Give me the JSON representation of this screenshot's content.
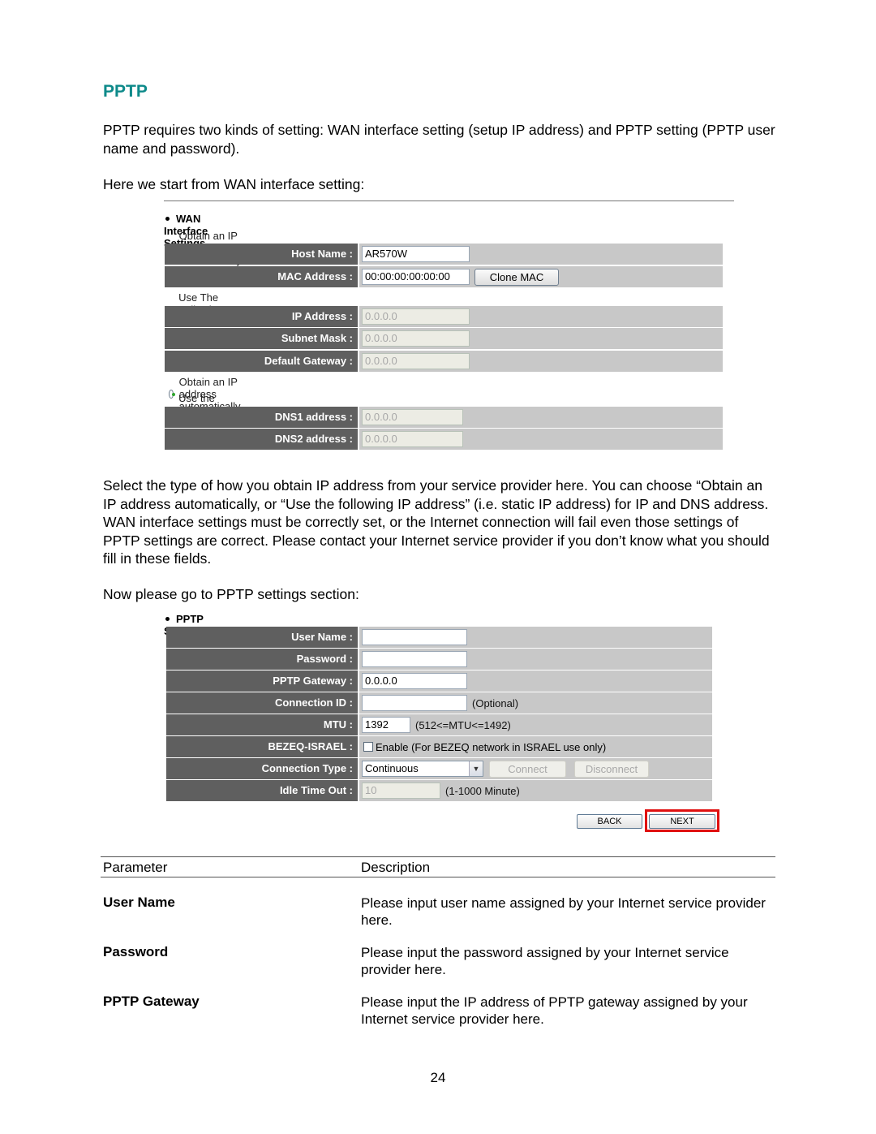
{
  "heading": "PPTP",
  "intro": "PPTP requires two kinds of setting: WAN interface setting (setup IP address) and PPTP setting (PPTP user name and password).",
  "wan_lead": "Here we start from WAN interface setting:",
  "wan_panel": {
    "title": "WAN Interface Settings",
    "radio_obtain_ip": "Obtain an IP Address Automatically",
    "host_name_label": "Host Name :",
    "host_name_value": "AR570W",
    "mac_label": "MAC Address :",
    "mac_value": "00:00:00:00:00:00",
    "clone_mac_button": "Clone MAC",
    "radio_use_ip": "Use The Following IP Address",
    "ip_label": "IP Address :",
    "ip_value": "0.0.0.0",
    "subnet_label": "Subnet Mask :",
    "subnet_value": "0.0.0.0",
    "gateway_label": "Default Gateway :",
    "gateway_value": "0.0.0.0",
    "radio_obtain_dns": "Obtain an IP address automatically",
    "radio_use_dns": "Use the following IP address",
    "dns1_label": "DNS1 address :",
    "dns1_value": "0.0.0.0",
    "dns2_label": "DNS2 address :",
    "dns2_value": "0.0.0.0"
  },
  "explain": "Select the type of how you obtain IP address from your service provider here. You can choose “Obtain an IP address automatically, or “Use the following IP address” (i.e. static IP address) for IP and DNS address. WAN interface settings must be correctly set, or the Internet connection will fail even those settings of PPTP settings are correct. Please contact your Internet service provider if you don’t know what you should fill in these fields.",
  "pptp_lead": "Now please go to PPTP settings section:",
  "pptp_panel": {
    "title": "PPTP Settings",
    "user_label": "User Name :",
    "user_value": "",
    "password_label": "Password :",
    "password_value": "",
    "pptp_gateway_label": "PPTP Gateway :",
    "pptp_gateway_value": "0.0.0.0",
    "conn_id_label": "Connection ID :",
    "conn_id_value": "",
    "conn_id_note": "(Optional)",
    "mtu_label": "MTU :",
    "mtu_value": "1392",
    "mtu_note": "(512<=MTU<=1492)",
    "bezeq_label": "BEZEQ-ISRAEL :",
    "bezeq_note": "Enable (For BEZEQ network in ISRAEL use only)",
    "conn_type_label": "Connection Type :",
    "conn_type_value": "Continuous",
    "connect_button": "Connect",
    "disconnect_button": "Disconnect",
    "idle_label": "Idle Time Out :",
    "idle_value": "10",
    "idle_note": "(1-1000 Minute)",
    "back_button": "BACK",
    "next_button": "NEXT"
  },
  "param_table": {
    "headers": [
      "Parameter",
      "Description"
    ],
    "rows": [
      {
        "name": "User Name",
        "desc": "Please input user name assigned by your Internet service provider here."
      },
      {
        "name": "Password",
        "desc": "Please input the password assigned by your Internet service provider here."
      },
      {
        "name": "PPTP Gateway",
        "desc": "Please input the IP address of PPTP gateway assigned by your Internet service provider here."
      }
    ]
  },
  "page_number": "24"
}
